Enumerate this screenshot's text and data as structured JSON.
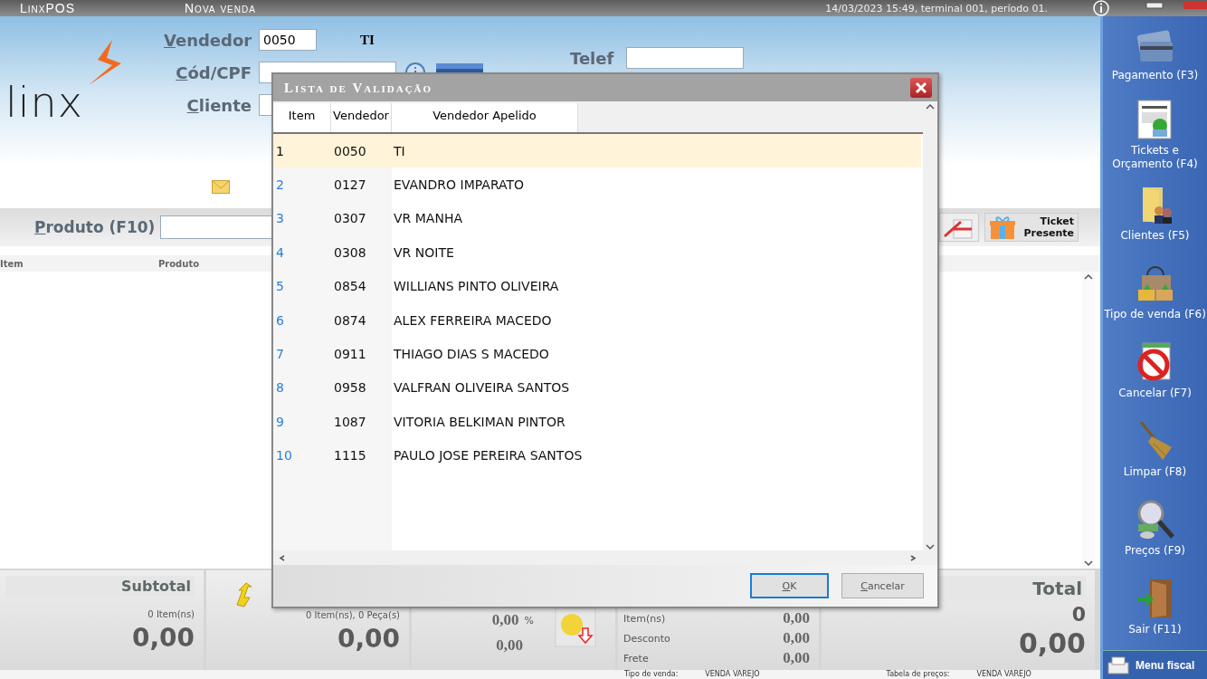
{
  "title_bar": {
    "app": "LinxPOS",
    "screen": "Nova venda",
    "status": "14/03/2023 15:49, terminal 001, período 01."
  },
  "header": {
    "logo": "linx",
    "fields": [
      {
        "label": "Vendedor",
        "value": "0050"
      },
      {
        "label": "Cód/CPF"
      },
      {
        "label": "Cliente"
      }
    ],
    "seller_name": "TI",
    "phone_label": "Telef"
  },
  "product_bar": {
    "label": "Produto (F10)",
    "ticket_button": "Ticket Presente"
  },
  "grid": {
    "columns": [
      "Item",
      "Produto"
    ]
  },
  "totals": {
    "subtotal": {
      "title": "Subtotal",
      "count": "0 Item(ns)",
      "value": "0,00"
    },
    "items": {
      "count": "0 Item(ns), 0 Peça(s)",
      "value": "0,00"
    },
    "discount": {
      "percent": "0,00",
      "percent_sign": "%",
      "value": "0,00"
    },
    "summary": [
      {
        "label": "Item(ns)",
        "value": "0,00"
      },
      {
        "label": "Desconto",
        "value": "0,00"
      },
      {
        "label": "Frete",
        "value": "0,00"
      }
    ],
    "total": {
      "title": "Total",
      "count": "0",
      "value": "0,00"
    }
  },
  "status_line": [
    {
      "label": "Tipo de venda:",
      "value": "VENDA VAREJO"
    },
    {
      "label": "Tabela de preços:",
      "value": "VENDA VAREJO"
    }
  ],
  "sidebar": {
    "items": [
      "Pagamento (F3)",
      "Tickets e Orçamento (F4)",
      "Clientes (F5)",
      "Tipo de venda (F6)",
      "Cancelar (F7)",
      "Limpar (F8)",
      "Preços (F9)",
      "Sair (F11)"
    ],
    "menu": "Menu fiscal"
  },
  "dialog": {
    "title": "Lista de Validação",
    "columns": [
      "Item",
      "Vendedor",
      "Vendedor Apelido"
    ],
    "rows": [
      {
        "item": "1",
        "code": "0050",
        "name": "TI",
        "selected": true
      },
      {
        "item": "2",
        "code": "0127",
        "name": "EVANDRO IMPARATO",
        "selected": false
      },
      {
        "item": "3",
        "code": "0307",
        "name": "VR MANHA",
        "selected": false
      },
      {
        "item": "4",
        "code": "0308",
        "name": "VR NOITE",
        "selected": false
      },
      {
        "item": "5",
        "code": "0854",
        "name": "WILLIANS PINTO OLIVEIRA",
        "selected": false
      },
      {
        "item": "6",
        "code": "0874",
        "name": "ALEX FERREIRA MACEDO",
        "selected": false
      },
      {
        "item": "7",
        "code": "0911",
        "name": "THIAGO DIAS S MACEDO",
        "selected": false
      },
      {
        "item": "8",
        "code": "0958",
        "name": "VALFRAN OLIVEIRA SANTOS",
        "selected": false
      },
      {
        "item": "9",
        "code": "1087",
        "name": "VITORIA BELKIMAN PINTOR",
        "selected": false
      },
      {
        "item": "10",
        "code": "1115",
        "name": "PAULO JOSE PEREIRA SANTOS",
        "selected": false
      }
    ],
    "buttons": [
      {
        "label": "OK",
        "focused": true
      },
      {
        "label": "Cancelar",
        "focused": false
      }
    ]
  }
}
